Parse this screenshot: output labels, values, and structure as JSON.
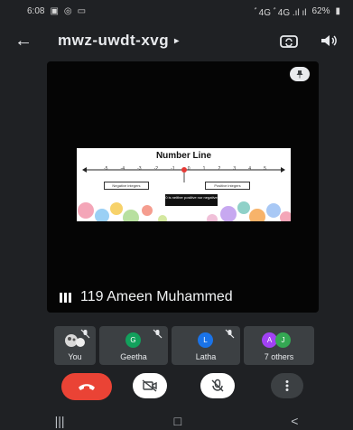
{
  "status_bar": {
    "time": "6:08",
    "battery": "62%",
    "indicators_text": "ﾞ4G ﾞ4G .ıl ıl"
  },
  "app_bar": {
    "title": "mwz-uwdt-xvg",
    "back_icon": "arrow-left-icon",
    "switch_camera_icon": "switch-camera-icon",
    "audio_icon": "speaker-icon"
  },
  "stage": {
    "pin_icon": "pin-icon",
    "slide": {
      "title": "Number Line",
      "ticks": [
        "-5",
        "-4",
        "-3",
        "-2",
        "-1",
        "0",
        "1",
        "2",
        "3",
        "4",
        "5"
      ],
      "negative_label": "Negative integers",
      "positive_label": "Positive integers",
      "zero_label": "0 is neither positive nor negative"
    },
    "speaker_name": "119 Ameen Muhammed"
  },
  "participants": [
    {
      "name": "You",
      "avatar_letter": "",
      "color": "#5f6368"
    },
    {
      "name": "Geetha",
      "avatar_letter": "G",
      "color": "#12a05c"
    },
    {
      "name": "Latha",
      "avatar_letter": "L",
      "color": "#1a73e8"
    },
    {
      "name": "7 others",
      "avatar_letters": [
        "A",
        "J"
      ],
      "colors": [
        "#a142f4",
        "#34a853"
      ]
    }
  ],
  "controls": {
    "end_call_icon": "phone-hangup-icon",
    "camera_icon": "camera-off-icon",
    "mic_icon": "mic-off-icon",
    "more_icon": "more-vert-icon",
    "end_call_color": "#ea4335"
  },
  "nav_bar": {
    "recents_icon": "recents-icon",
    "home_icon": "home-icon",
    "back_icon": "back-icon"
  }
}
